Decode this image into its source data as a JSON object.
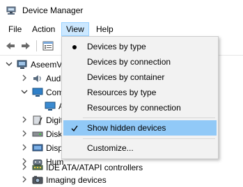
{
  "window": {
    "title": "Device Manager"
  },
  "menubar": {
    "file": "File",
    "action": "Action",
    "view": "View",
    "help": "Help"
  },
  "tree": {
    "root": "AseemV",
    "items": [
      {
        "label": "Aud",
        "icon": "speaker-icon"
      },
      {
        "label": "Com",
        "icon": "computer-icon"
      },
      {
        "label": "A",
        "icon": "monitor-icon"
      },
      {
        "label": "Digit",
        "icon": "digitizer-icon"
      },
      {
        "label": "Disk",
        "icon": "disk-drive-icon"
      },
      {
        "label": "Disp",
        "icon": "display-adapter-icon"
      },
      {
        "label": "Hum",
        "icon": "human-interface-icon"
      },
      {
        "label": "IDE ATA/ATAPI controllers",
        "icon": "ide-controller-icon"
      },
      {
        "label": "Imaging devices",
        "icon": "camera-icon"
      }
    ]
  },
  "view_menu": {
    "items": [
      {
        "label": "Devices by type",
        "mark": "radio-dot"
      },
      {
        "label": "Devices by connection",
        "mark": ""
      },
      {
        "label": "Devices by container",
        "mark": ""
      },
      {
        "label": "Resources by type",
        "mark": ""
      },
      {
        "label": "Resources by connection",
        "mark": ""
      },
      {
        "label": "Show hidden devices",
        "mark": "checkmark"
      },
      {
        "label": "Customize...",
        "mark": ""
      }
    ]
  },
  "colors": {
    "menu_highlight": "#91c9f7",
    "menu_background": "#f2f2f2",
    "active_menu": "#cce8ff"
  }
}
